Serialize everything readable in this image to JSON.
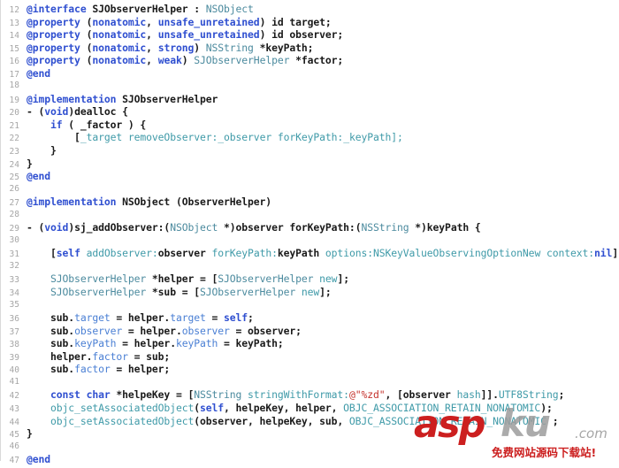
{
  "editor": {
    "language": "Objective-C",
    "first_line_number": 12,
    "last_line_number": 47,
    "background_color": "#ffffff",
    "gutter_color": "#a6a6a6",
    "colors": {
      "keyword": "#2f4fd0",
      "type": "#4b8a9e",
      "method": "#3f9aa8",
      "property": "#4a7fd4",
      "string": "#c4322c",
      "plain": "#1a1a1a"
    }
  },
  "lines": [
    {
      "n": "12",
      "tokens": [
        {
          "t": "@interface ",
          "c": "kw"
        },
        {
          "t": "SJObserverHelper ",
          "c": "plain"
        },
        {
          "t": ": ",
          "c": "plain"
        },
        {
          "t": "NSObject",
          "c": "type"
        }
      ]
    },
    {
      "n": "13",
      "tokens": [
        {
          "t": "@property ",
          "c": "kw"
        },
        {
          "t": "(",
          "c": "plain"
        },
        {
          "t": "nonatomic",
          "c": "kw"
        },
        {
          "t": ", ",
          "c": "plain"
        },
        {
          "t": "unsafe_unretained",
          "c": "kw"
        },
        {
          "t": ") ",
          "c": "plain"
        },
        {
          "t": "id ",
          "c": "plain"
        },
        {
          "t": "target;",
          "c": "plain"
        }
      ]
    },
    {
      "n": "14",
      "tokens": [
        {
          "t": "@property ",
          "c": "kw"
        },
        {
          "t": "(",
          "c": "plain"
        },
        {
          "t": "nonatomic",
          "c": "kw"
        },
        {
          "t": ", ",
          "c": "plain"
        },
        {
          "t": "unsafe_unretained",
          "c": "kw"
        },
        {
          "t": ") ",
          "c": "plain"
        },
        {
          "t": "id ",
          "c": "plain"
        },
        {
          "t": "observer;",
          "c": "plain"
        }
      ]
    },
    {
      "n": "15",
      "tokens": [
        {
          "t": "@property ",
          "c": "kw"
        },
        {
          "t": "(",
          "c": "plain"
        },
        {
          "t": "nonatomic",
          "c": "kw"
        },
        {
          "t": ", ",
          "c": "plain"
        },
        {
          "t": "strong",
          "c": "kw"
        },
        {
          "t": ") ",
          "c": "plain"
        },
        {
          "t": "NSString ",
          "c": "type"
        },
        {
          "t": "*keyPath;",
          "c": "plain"
        }
      ]
    },
    {
      "n": "16",
      "tokens": [
        {
          "t": "@property ",
          "c": "kw"
        },
        {
          "t": "(",
          "c": "plain"
        },
        {
          "t": "nonatomic",
          "c": "kw"
        },
        {
          "t": ", ",
          "c": "plain"
        },
        {
          "t": "weak",
          "c": "kw"
        },
        {
          "t": ") ",
          "c": "plain"
        },
        {
          "t": "SJObserverHelper ",
          "c": "type"
        },
        {
          "t": "*factor;",
          "c": "plain"
        }
      ]
    },
    {
      "n": "17",
      "tokens": [
        {
          "t": "@end",
          "c": "kw"
        }
      ]
    },
    {
      "n": "18",
      "tokens": []
    },
    {
      "n": "19",
      "tokens": [
        {
          "t": "@implementation ",
          "c": "kw"
        },
        {
          "t": "SJObserverHelper",
          "c": "plain"
        }
      ]
    },
    {
      "n": "20",
      "tokens": [
        {
          "t": "- (",
          "c": "plain"
        },
        {
          "t": "void",
          "c": "kw"
        },
        {
          "t": ")dealloc {",
          "c": "plain"
        }
      ]
    },
    {
      "n": "21",
      "tokens": [
        {
          "t": "    ",
          "c": "plain"
        },
        {
          "t": "if",
          "c": "kw"
        },
        {
          "t": " ( ",
          "c": "plain"
        },
        {
          "t": "_factor",
          "c": "plain"
        },
        {
          "t": " ) {",
          "c": "plain"
        }
      ]
    },
    {
      "n": "22",
      "tokens": [
        {
          "t": "        [",
          "c": "plain"
        },
        {
          "t": "_target ",
          "c": "meth"
        },
        {
          "t": "removeObserver:",
          "c": "meth"
        },
        {
          "t": "_observer ",
          "c": "meth"
        },
        {
          "t": "forKeyPath:",
          "c": "meth"
        },
        {
          "t": "_keyPath];",
          "c": "meth"
        }
      ]
    },
    {
      "n": "23",
      "tokens": [
        {
          "t": "    }",
          "c": "plain"
        }
      ]
    },
    {
      "n": "24",
      "tokens": [
        {
          "t": "}",
          "c": "plain"
        }
      ]
    },
    {
      "n": "25",
      "tokens": [
        {
          "t": "@end",
          "c": "kw"
        }
      ]
    },
    {
      "n": "26",
      "tokens": []
    },
    {
      "n": "27",
      "tokens": [
        {
          "t": "@implementation ",
          "c": "kw"
        },
        {
          "t": "NSObject (ObserverHelper)",
          "c": "plain"
        }
      ]
    },
    {
      "n": "28",
      "tokens": []
    },
    {
      "n": "29",
      "tokens": [
        {
          "t": "- (",
          "c": "plain"
        },
        {
          "t": "void",
          "c": "kw"
        },
        {
          "t": ")sj_addObserver:(",
          "c": "plain"
        },
        {
          "t": "NSObject",
          "c": "type"
        },
        {
          "t": " *)observer forKeyPath:(",
          "c": "plain"
        },
        {
          "t": "NSString",
          "c": "type"
        },
        {
          "t": " *)keyPath {",
          "c": "plain"
        }
      ]
    },
    {
      "n": "30",
      "tokens": []
    },
    {
      "n": "31",
      "tokens": [
        {
          "t": "    [",
          "c": "plain"
        },
        {
          "t": "self",
          "c": "kw"
        },
        {
          "t": " ",
          "c": "plain"
        },
        {
          "t": "addObserver:",
          "c": "meth"
        },
        {
          "t": "observer ",
          "c": "plain"
        },
        {
          "t": "forKeyPath:",
          "c": "meth"
        },
        {
          "t": "keyPath ",
          "c": "plain"
        },
        {
          "t": "options:",
          "c": "meth"
        },
        {
          "t": "NSKeyValueObservingOptionNew ",
          "c": "meth"
        },
        {
          "t": "context:",
          "c": "meth"
        },
        {
          "t": "nil",
          "c": "kw"
        },
        {
          "t": "];",
          "c": "plain"
        }
      ]
    },
    {
      "n": "32",
      "tokens": []
    },
    {
      "n": "33",
      "tokens": [
        {
          "t": "    ",
          "c": "plain"
        },
        {
          "t": "SJObserverHelper ",
          "c": "type"
        },
        {
          "t": "*helper = [",
          "c": "plain"
        },
        {
          "t": "SJObserverHelper ",
          "c": "type"
        },
        {
          "t": "new",
          "c": "meth"
        },
        {
          "t": "];",
          "c": "plain"
        }
      ]
    },
    {
      "n": "34",
      "tokens": [
        {
          "t": "    ",
          "c": "plain"
        },
        {
          "t": "SJObserverHelper ",
          "c": "type"
        },
        {
          "t": "*sub = [",
          "c": "plain"
        },
        {
          "t": "SJObserverHelper ",
          "c": "type"
        },
        {
          "t": "new",
          "c": "meth"
        },
        {
          "t": "];",
          "c": "plain"
        }
      ]
    },
    {
      "n": "35",
      "tokens": []
    },
    {
      "n": "36",
      "tokens": [
        {
          "t": "    sub.",
          "c": "plain"
        },
        {
          "t": "target",
          "c": "prop"
        },
        {
          "t": " = helper.",
          "c": "plain"
        },
        {
          "t": "target",
          "c": "prop"
        },
        {
          "t": " = ",
          "c": "plain"
        },
        {
          "t": "self",
          "c": "kw"
        },
        {
          "t": ";",
          "c": "plain"
        }
      ]
    },
    {
      "n": "37",
      "tokens": [
        {
          "t": "    sub.",
          "c": "plain"
        },
        {
          "t": "observer",
          "c": "prop"
        },
        {
          "t": " = helper.",
          "c": "plain"
        },
        {
          "t": "observer",
          "c": "prop"
        },
        {
          "t": " = observer;",
          "c": "plain"
        }
      ]
    },
    {
      "n": "38",
      "tokens": [
        {
          "t": "    sub.",
          "c": "plain"
        },
        {
          "t": "keyPath",
          "c": "prop"
        },
        {
          "t": " = helper.",
          "c": "plain"
        },
        {
          "t": "keyPath",
          "c": "prop"
        },
        {
          "t": " = keyPath;",
          "c": "plain"
        }
      ]
    },
    {
      "n": "39",
      "tokens": [
        {
          "t": "    helper.",
          "c": "plain"
        },
        {
          "t": "factor",
          "c": "prop"
        },
        {
          "t": " = sub;",
          "c": "plain"
        }
      ]
    },
    {
      "n": "40",
      "tokens": [
        {
          "t": "    sub.",
          "c": "plain"
        },
        {
          "t": "factor",
          "c": "prop"
        },
        {
          "t": " = helper;",
          "c": "plain"
        }
      ]
    },
    {
      "n": "41",
      "tokens": []
    },
    {
      "n": "42",
      "tokens": [
        {
          "t": "    ",
          "c": "plain"
        },
        {
          "t": "const char",
          "c": "kw"
        },
        {
          "t": " *helpeKey = [",
          "c": "plain"
        },
        {
          "t": "NSString ",
          "c": "type"
        },
        {
          "t": "stringWithFormat:",
          "c": "meth"
        },
        {
          "t": "@\"%zd\"",
          "c": "str"
        },
        {
          "t": ", [observer ",
          "c": "plain"
        },
        {
          "t": "hash",
          "c": "meth"
        },
        {
          "t": "]].",
          "c": "plain"
        },
        {
          "t": "UTF8String",
          "c": "meth"
        },
        {
          "t": ";",
          "c": "plain"
        }
      ]
    },
    {
      "n": "43",
      "tokens": [
        {
          "t": "    ",
          "c": "plain"
        },
        {
          "t": "objc_setAssociatedObject",
          "c": "meth"
        },
        {
          "t": "(",
          "c": "plain"
        },
        {
          "t": "self",
          "c": "kw"
        },
        {
          "t": ", helpeKey, helper, ",
          "c": "plain"
        },
        {
          "t": "OBJC_ASSOCIATION_RETAIN_NONATOMIC",
          "c": "meth"
        },
        {
          "t": ");",
          "c": "plain"
        }
      ]
    },
    {
      "n": "44",
      "tokens": [
        {
          "t": "    ",
          "c": "plain"
        },
        {
          "t": "objc_setAssociatedObject",
          "c": "meth"
        },
        {
          "t": "(observer, helpeKey, sub, ",
          "c": "plain"
        },
        {
          "t": "OBJC_ASSOCIATION_RETAIN_NONATOMIC",
          "c": "meth"
        },
        {
          "t": " ;",
          "c": "plain"
        }
      ]
    },
    {
      "n": "45",
      "tokens": [
        {
          "t": "}",
          "c": "plain"
        }
      ]
    },
    {
      "n": "46",
      "tokens": []
    },
    {
      "n": "47",
      "tokens": [
        {
          "t": "@end",
          "c": "kw"
        }
      ]
    }
  ],
  "watermark": {
    "brand_primary": "asp",
    "brand_secondary": "ku",
    "brand_tld": ".com",
    "tagline": "免费网站源码下载站!",
    "primary_color": "#cc1f1f",
    "secondary_color": "#9d9d9d"
  }
}
